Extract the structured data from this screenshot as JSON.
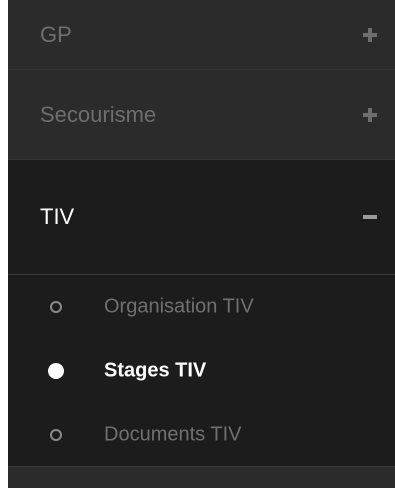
{
  "menu": {
    "items": [
      {
        "label": "GP",
        "toggle": "plus-icon",
        "expanded": false
      },
      {
        "label": "Secourisme",
        "toggle": "plus-icon",
        "expanded": false
      },
      {
        "label": "TIV",
        "toggle": "minus-icon",
        "expanded": true
      }
    ],
    "submenu": [
      {
        "label": "Organisation TIV",
        "active": false
      },
      {
        "label": "Stages TIV",
        "active": true
      },
      {
        "label": "Documents TIV",
        "active": false
      }
    ]
  },
  "colors": {
    "menu_bg": "#2b2b2b",
    "active_bg": "#1c1c1c",
    "inactive_text": "#6e6e6e",
    "active_text": "#ffffff"
  }
}
